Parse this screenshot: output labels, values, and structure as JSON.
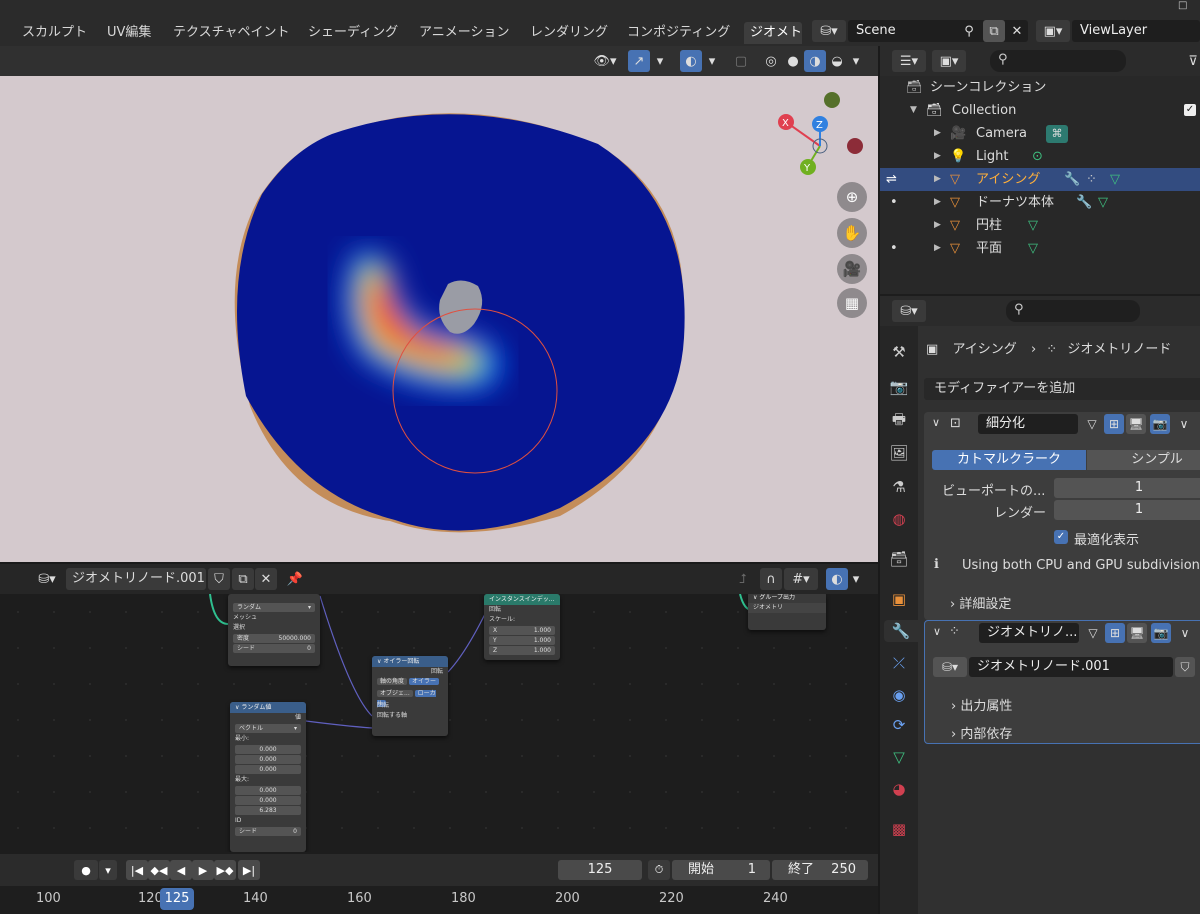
{
  "topbar": {
    "workspaces": [
      "スカルプト",
      "UV編集",
      "テクスチャペイント",
      "シェーディング",
      "アニメーション",
      "レンダリング",
      "コンポジティング",
      "ジオメト"
    ],
    "scene": "Scene",
    "view_layer": "ViewLayer"
  },
  "node_editor": {
    "tree_name": "ジオメトリノード.001",
    "nodes": {
      "distribute": {
        "dropdown": "ランダム",
        "mesh": "メッシュ",
        "selection": "選択",
        "density_label": "密度",
        "density_value": "50000.000",
        "seed_label": "シード",
        "seed_value": "0"
      },
      "instance": {
        "title": "インスタンスインデッ...",
        "rotation": "回転",
        "scale": "スケール:",
        "x": "X",
        "x_value": "1.000",
        "y": "Y",
        "y_value": "1.000",
        "z": "Z",
        "z_value": "1.000"
      },
      "euler": {
        "title": "オイラー回転",
        "rotation_out": "回転",
        "axis_angle": "軸の角度",
        "euler_btn": "オイラー",
        "object": "オブジェ...",
        "local": "ローカル",
        "rotation_in": "回転",
        "rotate_by": "回転する軸"
      },
      "random": {
        "title": "ランダム値",
        "value": "値",
        "type": "ベクトル",
        "min": "最小:",
        "min_values": [
          "0.000",
          "0.000",
          "0.000"
        ],
        "max": "最大:",
        "max_values": [
          "0.000",
          "0.000",
          "6.283"
        ],
        "id": "ID",
        "seed": "シード",
        "seed_value": "0"
      },
      "group_output": {
        "title": "グループ出力",
        "geometry": "ジオメトリ"
      }
    }
  },
  "timeline": {
    "current_frame": "125",
    "start_label": "開始",
    "start_value": "1",
    "end_label": "終了",
    "end_value": "250",
    "ruler": [
      "100",
      "120",
      "140",
      "160",
      "180",
      "200",
      "220",
      "240"
    ],
    "playhead": "125"
  },
  "outliner": {
    "scene_collection": "シーンコレクション",
    "items": [
      {
        "label": "Collection"
      },
      {
        "label": "Camera"
      },
      {
        "label": "Light"
      },
      {
        "label": "アイシング"
      },
      {
        "label": "ドーナツ本体"
      },
      {
        "label": "円柱"
      },
      {
        "label": "平面"
      }
    ]
  },
  "properties": {
    "breadcrumb_object": "アイシング",
    "breadcrumb_modifier": "ジオメトリノード",
    "add_modifier": "モディファイアーを追加",
    "subdiv": {
      "name": "細分化",
      "tab_catmull": "カトマルクラーク",
      "tab_simple": "シンプル",
      "viewport_label": "ビューポートの...",
      "viewport_value": "1",
      "render_label": "レンダー",
      "render_value": "1",
      "optimal_label": "最適化表示",
      "info": "Using both CPU and GPU subdivision",
      "advanced": "詳細設定"
    },
    "geonodes": {
      "name": "ジオメトリノ...",
      "tree": "ジオメトリノード.001",
      "output_attrs": "出力属性",
      "internal_deps": "内部依存"
    }
  },
  "colors": {
    "accent": "#4772b3",
    "selected_row": "#334c80",
    "header": "#303030"
  }
}
